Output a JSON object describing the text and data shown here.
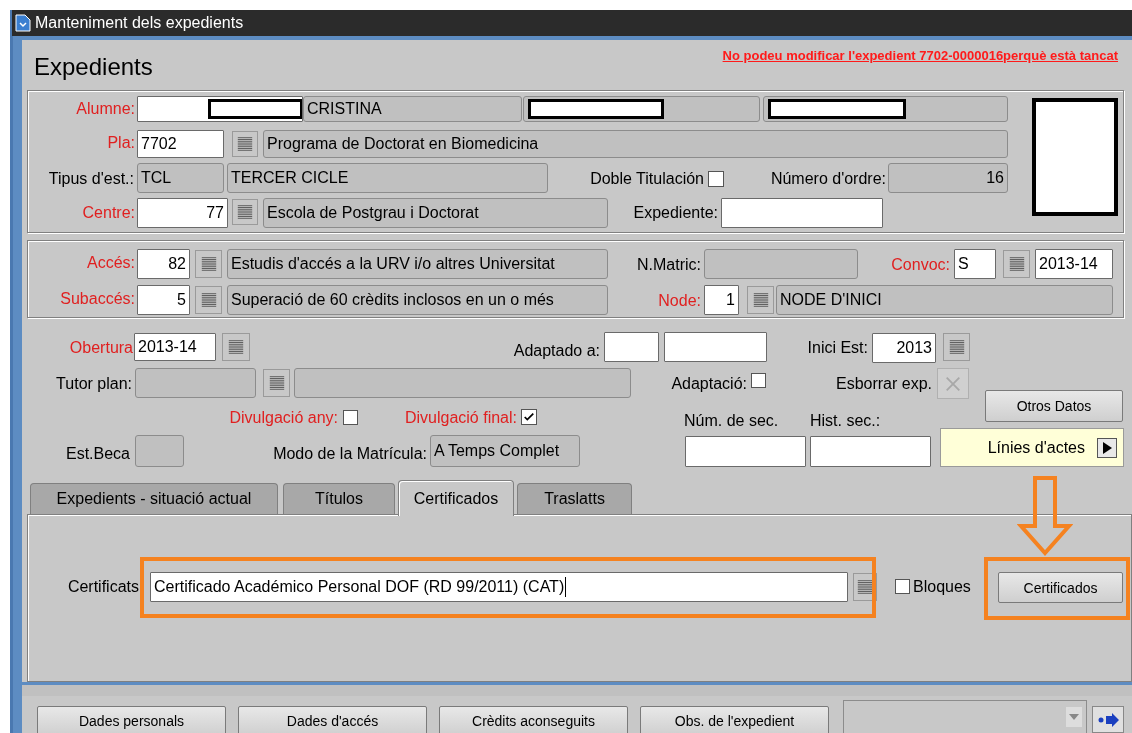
{
  "window": {
    "title": "Manteniment dels expedients"
  },
  "header": {
    "title": "Expedients",
    "warning": "No podeu modificar l'expedient  7702-0000016perquè està tancat"
  },
  "form": {
    "items": [
      {
        "kind": "label",
        "text": "Alumne:",
        "required": true
      },
      {
        "kind": "field",
        "value": "",
        "editable": true,
        "redacted": true
      },
      {
        "kind": "field",
        "value": "CRISTINA",
        "editable": false,
        "redacted": false
      },
      {
        "kind": "field",
        "value": "",
        "editable": false,
        "redacted": true
      },
      {
        "kind": "field",
        "value": "",
        "editable": false,
        "redacted": true
      },
      {
        "kind": "photo"
      },
      {
        "kind": "label",
        "text": "Pla:",
        "required": true
      },
      {
        "kind": "field",
        "value": "7702",
        "editable": true,
        "redacted": false
      },
      {
        "kind": "lov"
      },
      {
        "kind": "field",
        "value": "Programa de Doctorat en Biomedicina",
        "editable": false,
        "redacted": false
      },
      {
        "kind": "label",
        "text": "Tipus d'est.:",
        "required": false
      },
      {
        "kind": "field",
        "value": "TCL",
        "editable": false,
        "redacted": false
      },
      {
        "kind": "field",
        "value": "TERCER CICLE",
        "editable": false,
        "redacted": false
      },
      {
        "kind": "label",
        "text": "Doble Titulación",
        "required": false
      },
      {
        "kind": "checkbox",
        "checked": false
      },
      {
        "kind": "label",
        "text": "Número d'ordre:",
        "required": false
      },
      {
        "kind": "field",
        "value": "16",
        "editable": false,
        "redacted": false
      },
      {
        "kind": "label",
        "text": "Centre:",
        "required": true
      },
      {
        "kind": "field",
        "value": "77",
        "editable": true,
        "redacted": false
      },
      {
        "kind": "lov"
      },
      {
        "kind": "field",
        "value": "Escola de Postgrau i Doctorat",
        "editable": false,
        "redacted": false
      },
      {
        "kind": "label",
        "text": "Expediente:",
        "required": false
      },
      {
        "kind": "field",
        "value": "",
        "editable": true,
        "redacted": false
      },
      {
        "kind": "label",
        "text": "Accés:",
        "required": true
      },
      {
        "kind": "field",
        "value": "82",
        "editable": true,
        "redacted": false
      },
      {
        "kind": "lov"
      },
      {
        "kind": "field",
        "value": "Estudis d'accés a la URV i/o altres Universitat",
        "editable": false,
        "redacted": false
      },
      {
        "kind": "label",
        "text": "N.Matric:",
        "required": false
      },
      {
        "kind": "field",
        "value": "",
        "editable": false,
        "redacted": false
      },
      {
        "kind": "label",
        "text": "Convoc:",
        "required": true
      },
      {
        "kind": "field",
        "value": "S",
        "editable": true,
        "redacted": false
      },
      {
        "kind": "lov"
      },
      {
        "kind": "field",
        "value": "2013-14",
        "editable": true,
        "redacted": false
      },
      {
        "kind": "label",
        "text": "Subaccés:",
        "required": true
      },
      {
        "kind": "field",
        "value": "5",
        "editable": true,
        "redacted": false
      },
      {
        "kind": "lov"
      },
      {
        "kind": "field",
        "value": "Superació de 60 crèdits inclosos en un o més",
        "editable": false,
        "redacted": false
      },
      {
        "kind": "label",
        "text": "Node:",
        "required": true
      },
      {
        "kind": "field",
        "value": "1",
        "editable": true,
        "redacted": false
      },
      {
        "kind": "lov"
      },
      {
        "kind": "field",
        "value": "NODE D'INICI",
        "editable": false,
        "redacted": false
      },
      {
        "kind": "label",
        "text": "Obertura",
        "required": true
      },
      {
        "kind": "field",
        "value": "2013-14",
        "editable": true,
        "redacted": false
      },
      {
        "kind": "lov"
      },
      {
        "kind": "label",
        "text": "Adaptado a:",
        "required": false
      },
      {
        "kind": "field",
        "value": "",
        "editable": true,
        "redacted": false
      },
      {
        "kind": "field",
        "value": "",
        "editable": true,
        "redacted": false
      },
      {
        "kind": "label",
        "text": "Inici Est:",
        "required": false
      },
      {
        "kind": "field",
        "value": "2013",
        "editable": true,
        "redacted": false
      },
      {
        "kind": "lov"
      },
      {
        "kind": "label",
        "text": "Tutor plan:",
        "required": false
      },
      {
        "kind": "field",
        "value": "",
        "editable": false,
        "redacted": false
      },
      {
        "kind": "lov"
      },
      {
        "kind": "field",
        "value": "",
        "editable": false,
        "redacted": false
      },
      {
        "kind": "label",
        "text": "Adaptació:",
        "required": false
      },
      {
        "kind": "checkbox",
        "checked": false
      },
      {
        "kind": "label",
        "text": "Esborrar exp.",
        "required": false
      },
      {
        "kind": "delete-button",
        "disabled": true
      },
      {
        "kind": "button",
        "text": "Otros Datos"
      },
      {
        "kind": "label",
        "text": "Divulgació any:",
        "required": true
      },
      {
        "kind": "checkbox",
        "checked": false
      },
      {
        "kind": "label",
        "text": "Divulgació final:",
        "required": true
      },
      {
        "kind": "checkbox",
        "checked": true
      },
      {
        "kind": "label",
        "text": "Núm. de sec.",
        "required": false
      },
      {
        "kind": "label",
        "text": "Hist. sec.:",
        "required": false
      },
      {
        "kind": "next-button",
        "text": "Línies d'actes"
      },
      {
        "kind": "label",
        "text": "Est.Beca",
        "required": false
      },
      {
        "kind": "field",
        "value": "",
        "editable": false,
        "redacted": false
      },
      {
        "kind": "label",
        "text": "Modo de la Matrícula:",
        "required": false
      },
      {
        "kind": "field",
        "value": "A Temps Complet",
        "editable": false,
        "redacted": false
      },
      {
        "kind": "field",
        "value": "",
        "editable": true,
        "redacted": false
      },
      {
        "kind": "field",
        "value": "",
        "editable": true,
        "redacted": false
      }
    ]
  },
  "tabs": [
    {
      "label": "Expedients - situació actual",
      "selected": false
    },
    {
      "label": "Títulos",
      "selected": false
    },
    {
      "label": "Certificados",
      "selected": true
    },
    {
      "label": "Traslatts",
      "selected": false
    }
  ],
  "certificates": {
    "label": "Certificats",
    "value": "Certificado Académico Personal DOF (RD 99/2011) (CAT)",
    "bloques": {
      "label": "Bloques",
      "checked": false
    },
    "button": "Certificados"
  },
  "bottom_buttons": [
    "Dades personals",
    "Dades d'accés",
    "Crèdits aconseguits",
    "Obs. de l'expedient"
  ]
}
